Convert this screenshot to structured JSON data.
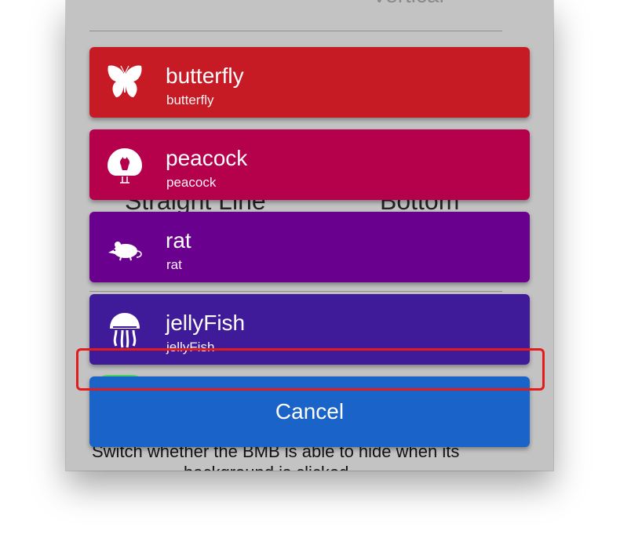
{
  "background": {
    "vertical_label": "Vertical",
    "straight_line_label": "Straight Line",
    "bottom_label": "Bottom",
    "switch_description_line1": "Switch whether the BMB is able to hide when its",
    "switch_description_line2": "background is clicked"
  },
  "menu": {
    "items": [
      {
        "title": "butterfly",
        "subtitle": "butterfly",
        "color": "#c61a24",
        "icon": "butterfly-icon"
      },
      {
        "title": "peacock",
        "subtitle": "peacock",
        "color": "#b5004c",
        "icon": "peacock-icon"
      },
      {
        "title": "rat",
        "subtitle": "rat",
        "color": "#6a018e",
        "icon": "rat-icon"
      },
      {
        "title": "jellyFish",
        "subtitle": "jellyFish",
        "color": "#3f1b9a",
        "icon": "jellyfish-icon"
      }
    ],
    "cancel_label": "Cancel",
    "cancel_color": "#1a63c9"
  },
  "highlight_color": "#e41b1b"
}
